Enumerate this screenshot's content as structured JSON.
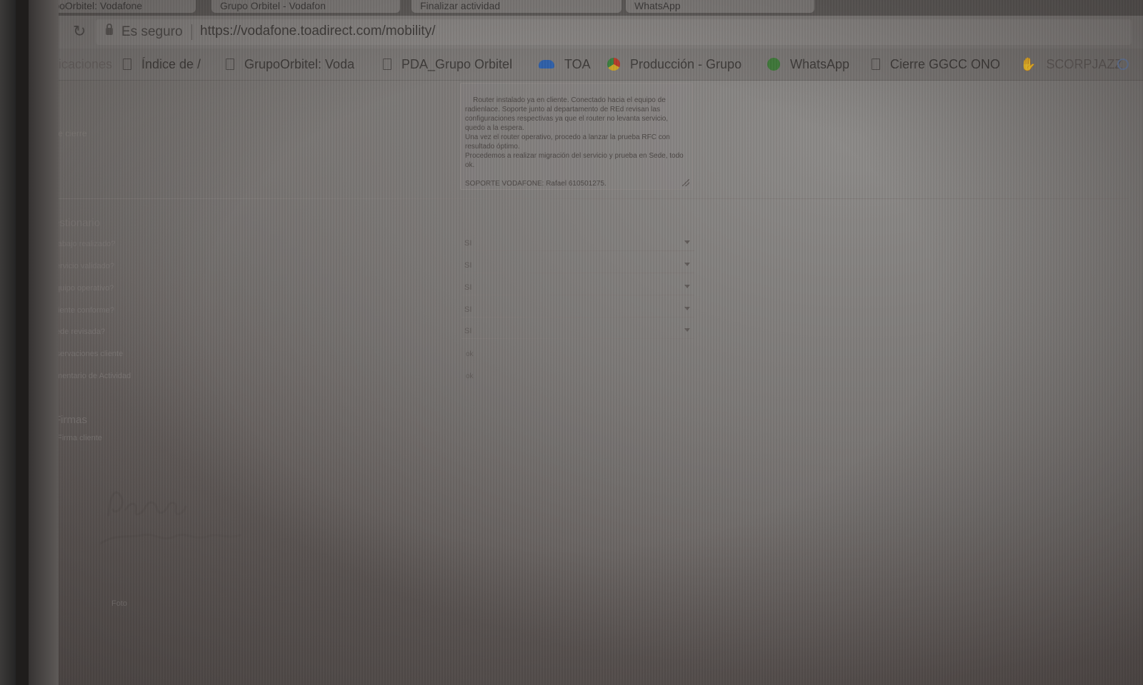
{
  "browser": {
    "tabs": [
      {
        "label": "GrupoOrbitel: Vodafone"
      },
      {
        "label": "Grupo Orbitel - Vodafon"
      },
      {
        "label": "Finalizar actividad"
      },
      {
        "label": "WhatsApp"
      }
    ],
    "secure_label": "Es seguro",
    "url": "https://vodafone.toadirect.com/mobility/",
    "bookmarks": [
      {
        "label": "Aplicaciones",
        "icon": "apps-icon"
      },
      {
        "label": "Índice de /",
        "icon": "page-icon"
      },
      {
        "label": "GrupoOrbitel: Voda",
        "icon": "page-icon"
      },
      {
        "label": "PDA_Grupo Orbitel",
        "icon": "page-icon"
      },
      {
        "label": "TOA",
        "icon": "cloud-icon"
      },
      {
        "label": "Producción - Grupo",
        "icon": "chrome-icon"
      },
      {
        "label": "WhatsApp",
        "icon": "whatsapp-icon"
      },
      {
        "label": "Cierre GGCC ONO",
        "icon": "page-icon"
      },
      {
        "label": "SCORPJAZZ",
        "icon": "hand-icon"
      }
    ]
  },
  "notes": {
    "label": "Nota de cierre",
    "text": "Router instalado ya en cliente. Conectado hacia el equipo de radienlace. Soporte junto al departamento de REd revisan las configuraciones respectivas ya que el router no levanta servicio, quedo a la espera.\nUna vez el router operativo, procedo a lanzar la prueba RFC con resultado óptimo.\nProcedemos a realizar migración del servicio y prueba en Sede, todo ok.\n\nSOPORTE VODAFONE: Rafael 610501275."
  },
  "questionnaire": {
    "title": "Cuestionario",
    "questions": [
      {
        "label": "¿Trabajo realizado?",
        "value": "SI"
      },
      {
        "label": "¿Servicio validado?",
        "value": "SI"
      },
      {
        "label": "¿Equipo operativo?",
        "value": "SI"
      },
      {
        "label": "¿Cliente conforme?",
        "value": "SI"
      },
      {
        "label": "¿Sede revisada?",
        "value": "SI"
      },
      {
        "label": "Observaciones cliente",
        "value": "ok"
      },
      {
        "label": "Comentario de Actividad",
        "value": "ok"
      }
    ]
  },
  "signatures": {
    "title": "Firmas",
    "signer_label": "Firma cliente",
    "footer_label": "Foto"
  },
  "colors": {
    "whatsapp": "#3f7a3a",
    "toa_cloud": "#2e5fa8"
  }
}
